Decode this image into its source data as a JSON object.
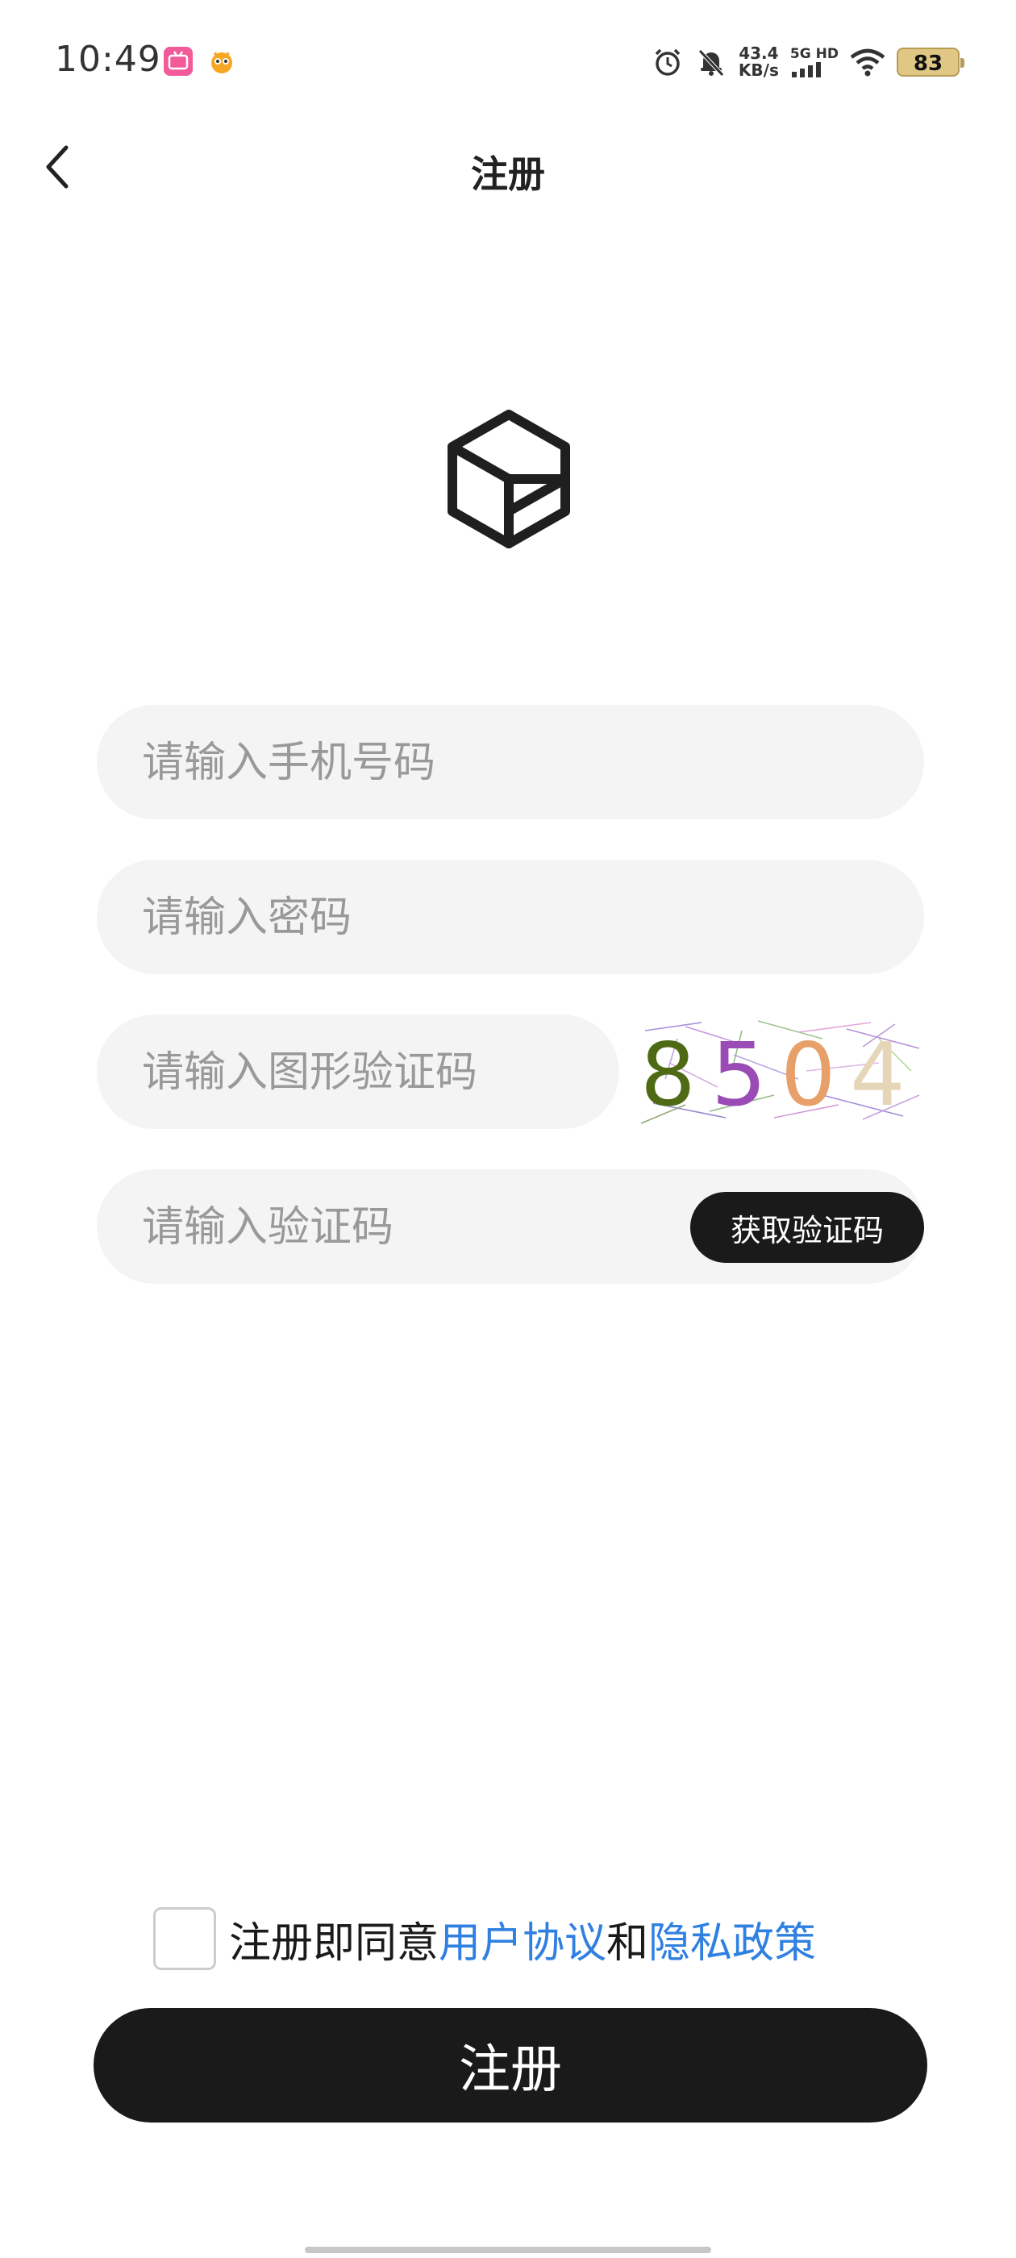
{
  "status_bar": {
    "time": "10:49",
    "app1_label": "bilibili",
    "net_speed_value": "43.4",
    "net_speed_unit": "KB/s",
    "signal_label_1": "5G",
    "signal_label_2": "HD",
    "battery": "83",
    "icons": [
      "alarm-icon",
      "mute-bell-icon",
      "signal-icon",
      "wifi-icon",
      "battery-icon"
    ]
  },
  "header": {
    "title": "注册",
    "back_icon": "chevron-left-icon"
  },
  "logo": {
    "icon": "hexagon-logo-icon"
  },
  "form": {
    "phone_placeholder": "请输入手机号码",
    "password_placeholder": "请输入密码",
    "captcha_placeholder": "请输入图形验证码",
    "captcha_text": "8504",
    "captcha_colors": [
      "#4f6a14",
      "#9b4bb5",
      "#e8a06a",
      "#e6d6b8"
    ],
    "code_placeholder": "请输入验证码",
    "get_code_label": "获取验证码"
  },
  "agreement": {
    "prefix": "注册即同意",
    "user_agreement": "用户协议",
    "and": "和",
    "privacy_policy": "隐私政策",
    "checked": false
  },
  "register_label": "注册",
  "colors": {
    "primary": "#1a1a1a",
    "link": "#2f80e0",
    "field_bg": "#f4f4f4",
    "placeholder": "#999999"
  }
}
